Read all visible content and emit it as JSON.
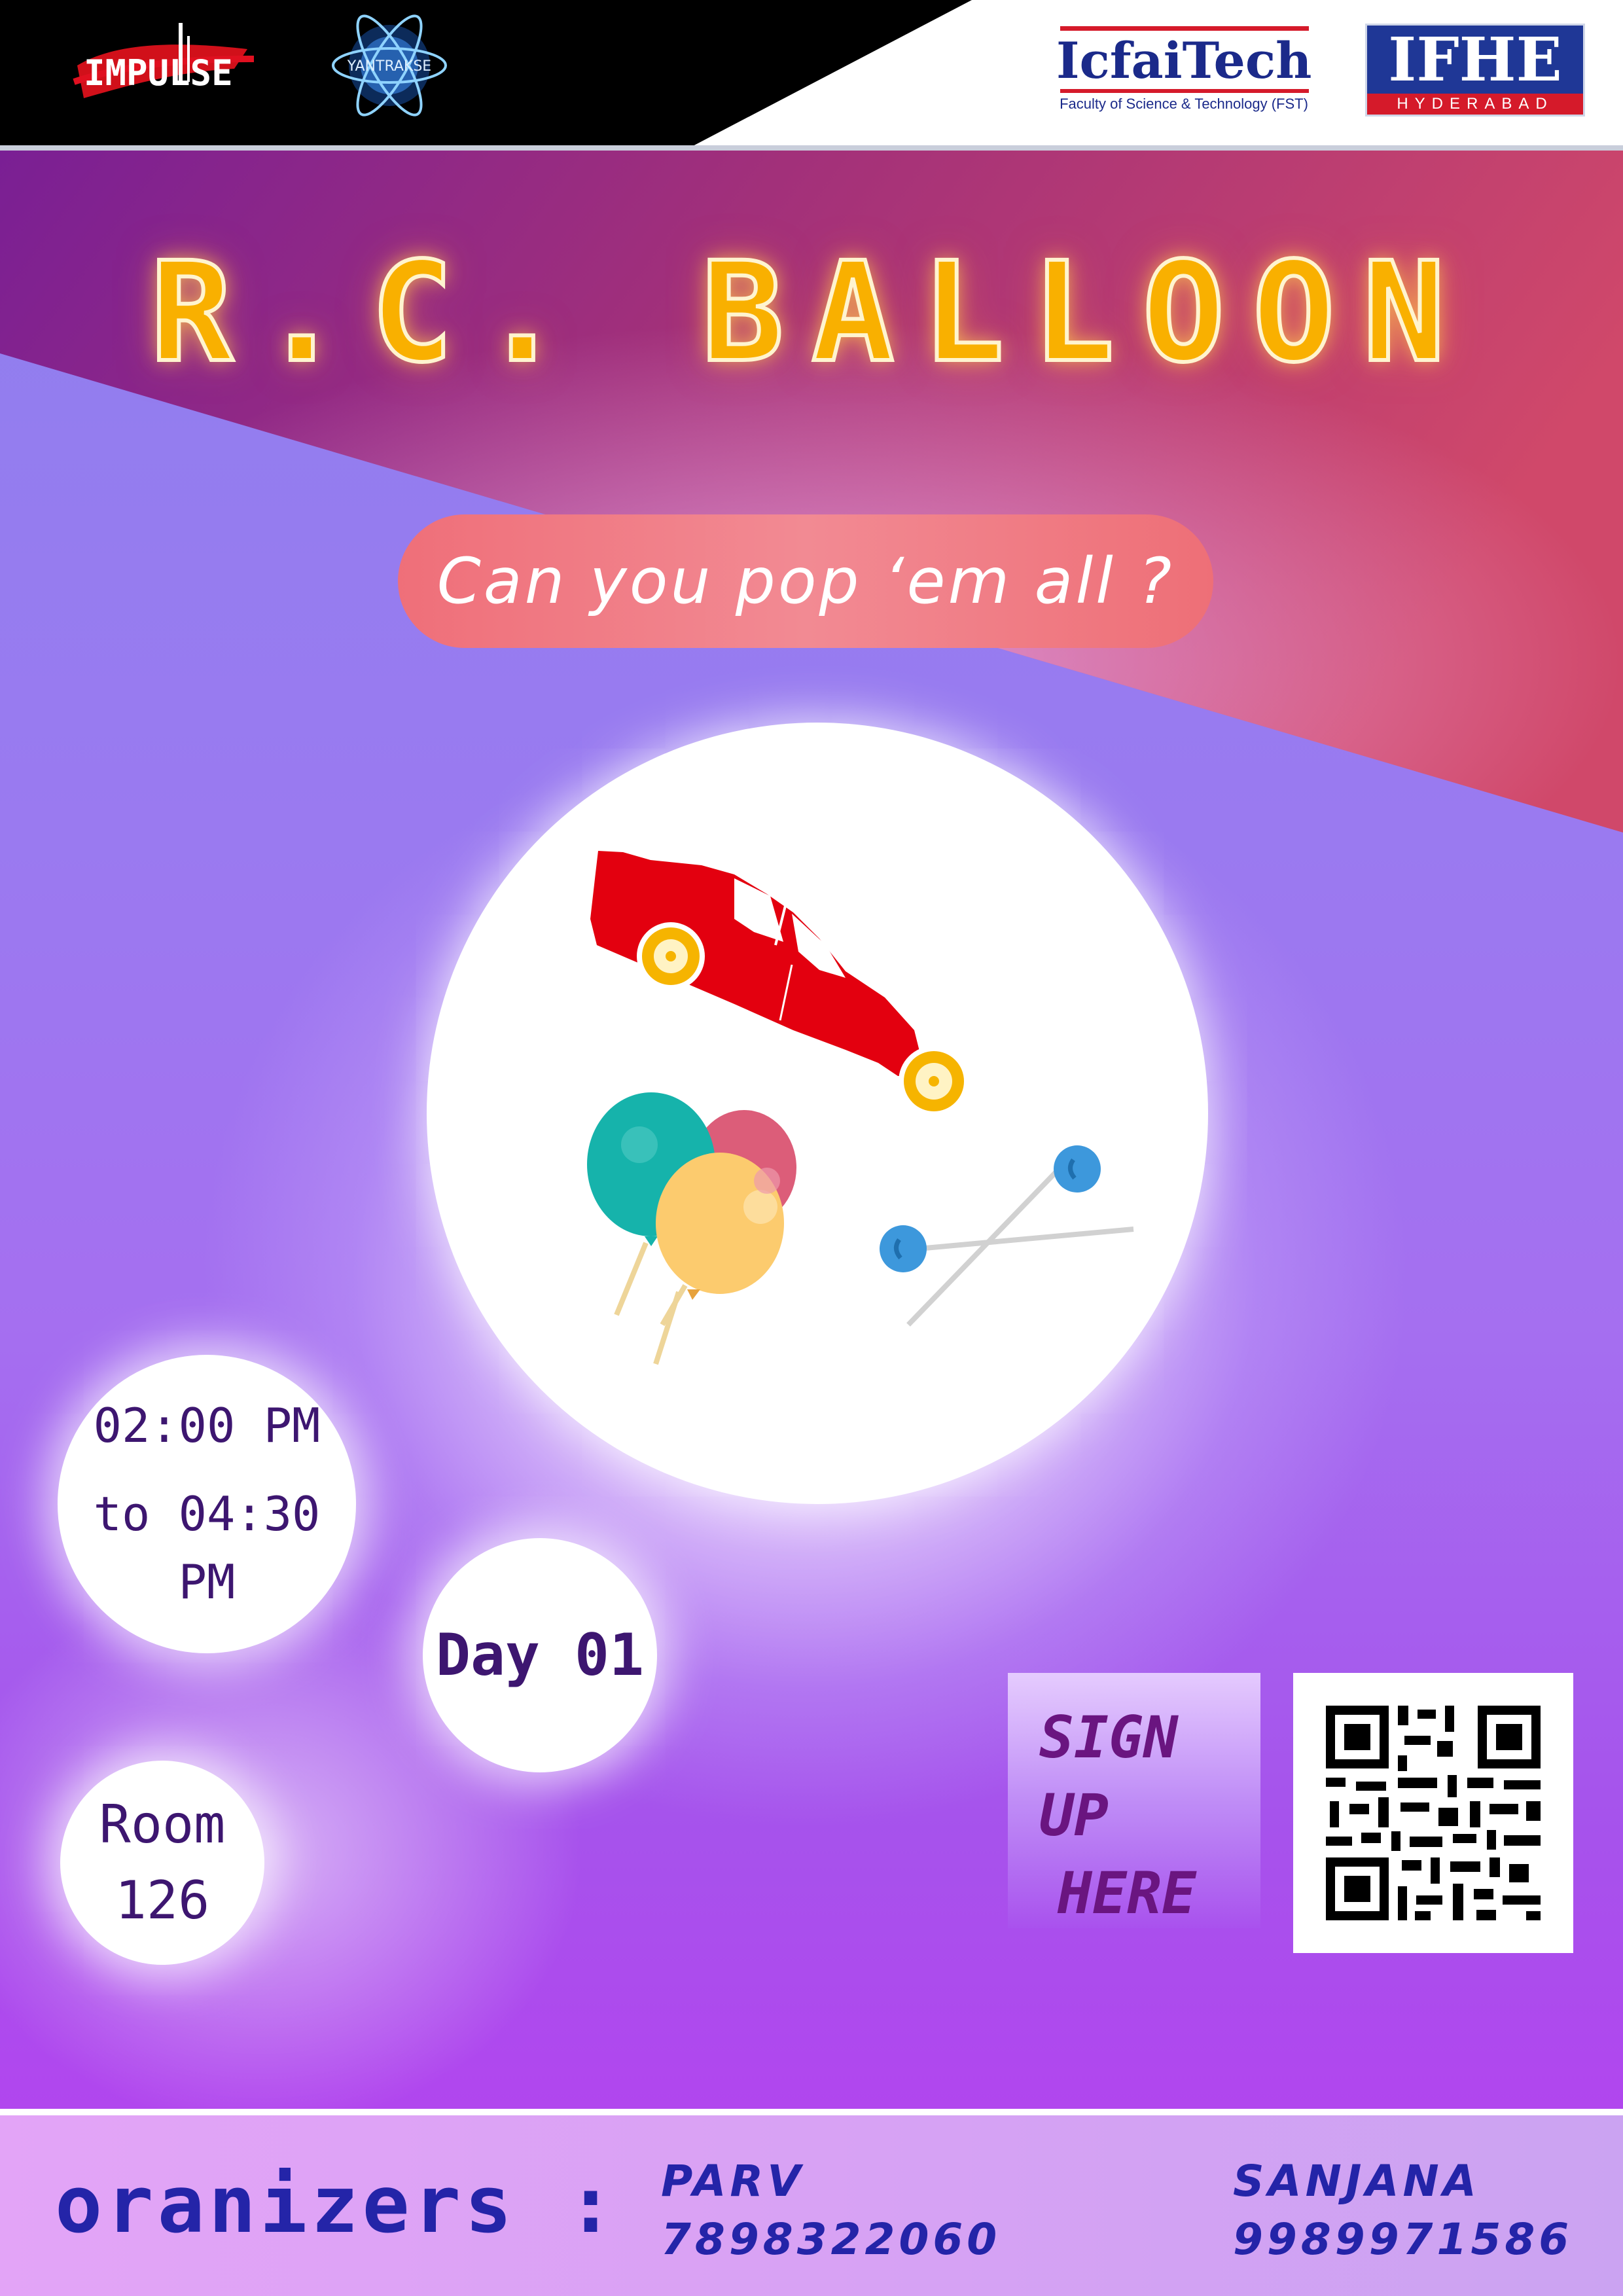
{
  "header": {
    "logo_impulse": "IMPULSE",
    "logo_yantraksh": "YANTRAKSE",
    "icfaitech": {
      "name": "IcfaiTech",
      "sub": "Faculty of Science & Technology (FST)"
    },
    "ifhe": {
      "name": "IFHE",
      "sub": "HYDERABAD"
    }
  },
  "event": {
    "title": "R.C. BALLOON",
    "tagline": "Can you pop ‘em all ?"
  },
  "schedule": {
    "time_line1": "02:00 PM",
    "time_line2": "to 04:30 PM",
    "day": "Day 01",
    "room_line1": "Room",
    "room_line2": "126"
  },
  "signup": {
    "line1": "SIGN UP",
    "line2": "HERE"
  },
  "footer": {
    "label": "oranizers :",
    "organizers": [
      {
        "name": "PARV",
        "phone": "7898322060"
      },
      {
        "name": "SANJANA",
        "phone": "9989971586"
      }
    ]
  },
  "colors": {
    "title": "#f9b000",
    "tagline_bg": "#ef6f79",
    "info_text": "#3d1670",
    "organizer_text": "#2424a8",
    "car": "#e3000f"
  }
}
